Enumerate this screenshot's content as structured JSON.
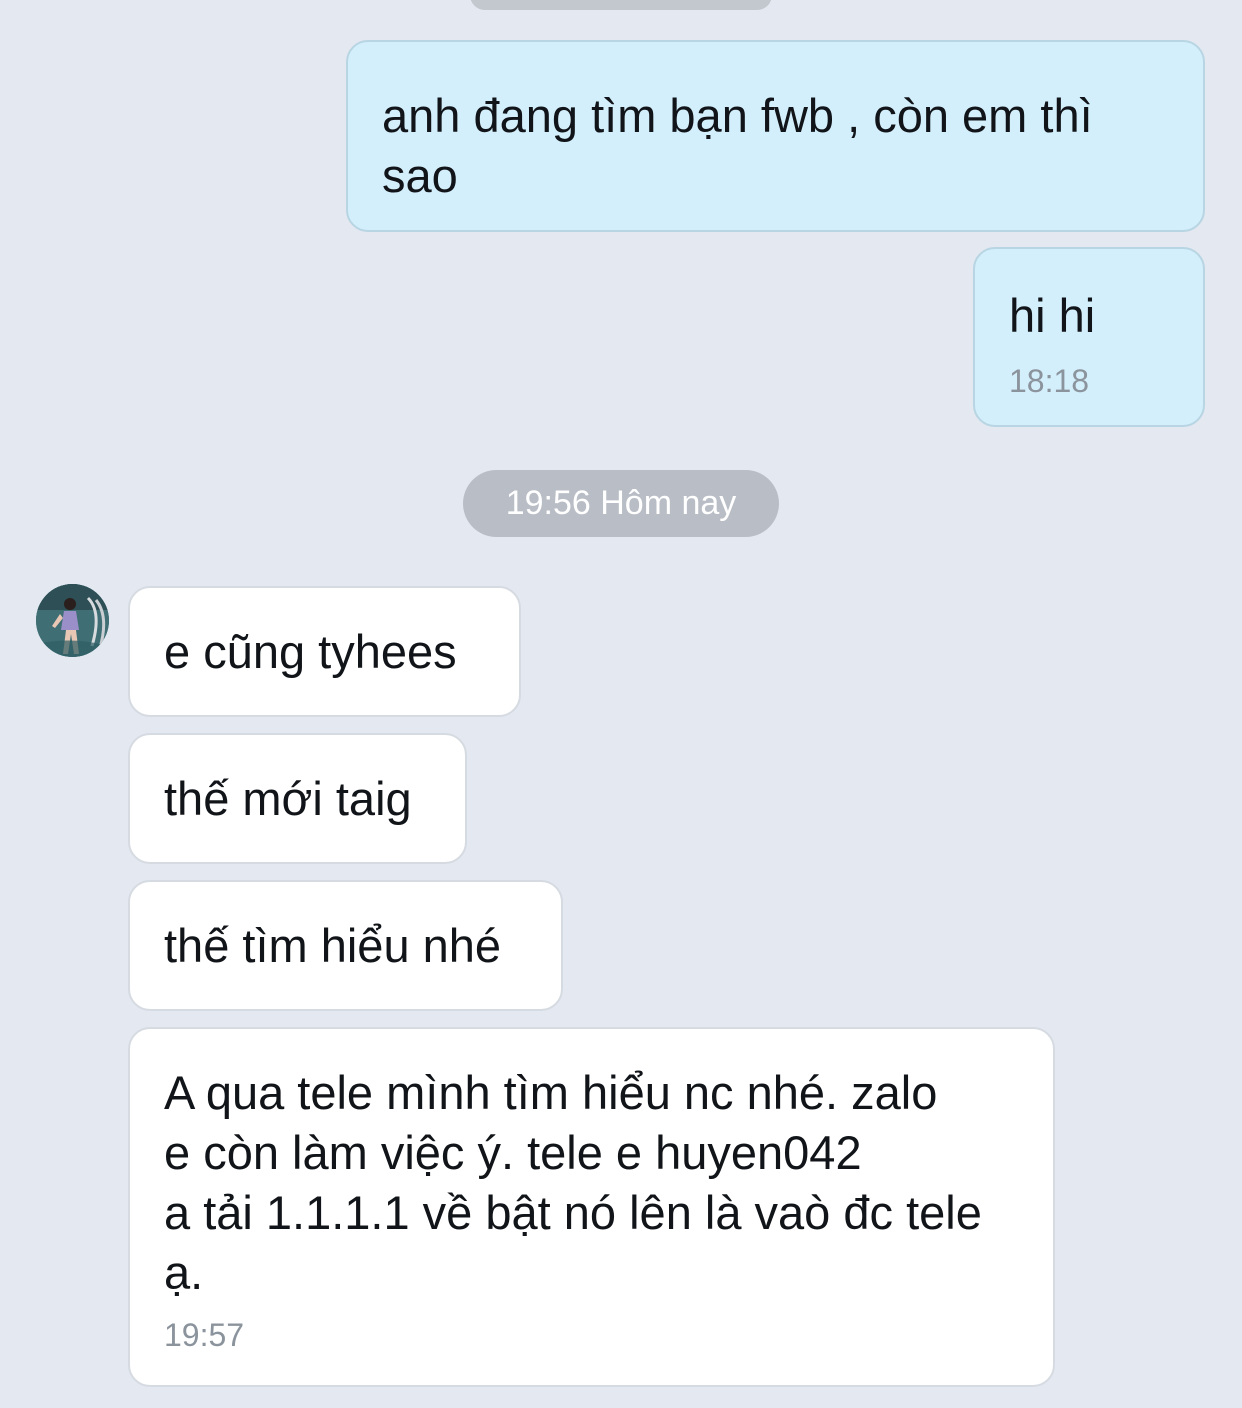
{
  "chat": {
    "date_separator": "19:56 Hôm nay",
    "messages": [
      {
        "direction": "sent",
        "text": "anh đang tìm bạn fwb , còn em thì\nsao",
        "time": ""
      },
      {
        "direction": "sent",
        "text": "hi hi",
        "time": "18:18"
      },
      {
        "direction": "received",
        "text": "e cũng tyhees",
        "time": ""
      },
      {
        "direction": "received",
        "text": "thế mới taig",
        "time": ""
      },
      {
        "direction": "received",
        "text": "thế tìm hiểu nhé",
        "time": ""
      },
      {
        "direction": "received",
        "text": "A qua tele mình tìm hiểu nc nhé. zalo\ne còn làm việc ý. tele e huyen042\na tải 1.1.1.1 về bật nó lên là vaò đc tele\nạ.",
        "time": "19:57"
      }
    ]
  },
  "colors": {
    "background": "#e3e8f1",
    "sent_bubble": "#d4effc",
    "received_bubble": "#ffffff",
    "date_pill": "#b9bec6",
    "timestamp": "#8b939c"
  },
  "icons": {
    "contact_avatar": "avatar-photo"
  }
}
